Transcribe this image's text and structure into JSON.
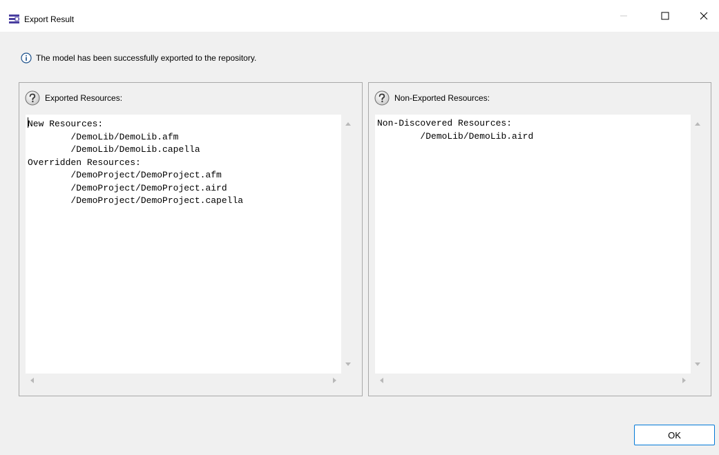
{
  "window": {
    "title": "Export Result",
    "icon": "app-dialog-icon",
    "controls": {
      "minimize_icon": "minimize-icon",
      "maximize_icon": "maximize-icon",
      "close_icon": "close-icon"
    }
  },
  "info": {
    "icon": "info-icon",
    "message": "The model has been successfully exported to the repository."
  },
  "exported": {
    "icon": "help-icon",
    "label": "Exported Resources:",
    "content": "New Resources:\n\t/DemoLib/DemoLib.afm\n\t/DemoLib/DemoLib.capella\nOverridden Resources:\n\t/DemoProject/DemoProject.afm\n\t/DemoProject/DemoProject.aird\n\t/DemoProject/DemoProject.capella"
  },
  "non_exported": {
    "icon": "help-icon",
    "label": "Non-Exported Resources:",
    "content": "Non-Discovered Resources:\n\t/DemoLib/DemoLib.aird"
  },
  "buttons": {
    "ok_label": "OK"
  },
  "colors": {
    "accent": "#0078d7",
    "info_icon": "#1a4f8a",
    "app_icon": "#4a3fa0"
  }
}
